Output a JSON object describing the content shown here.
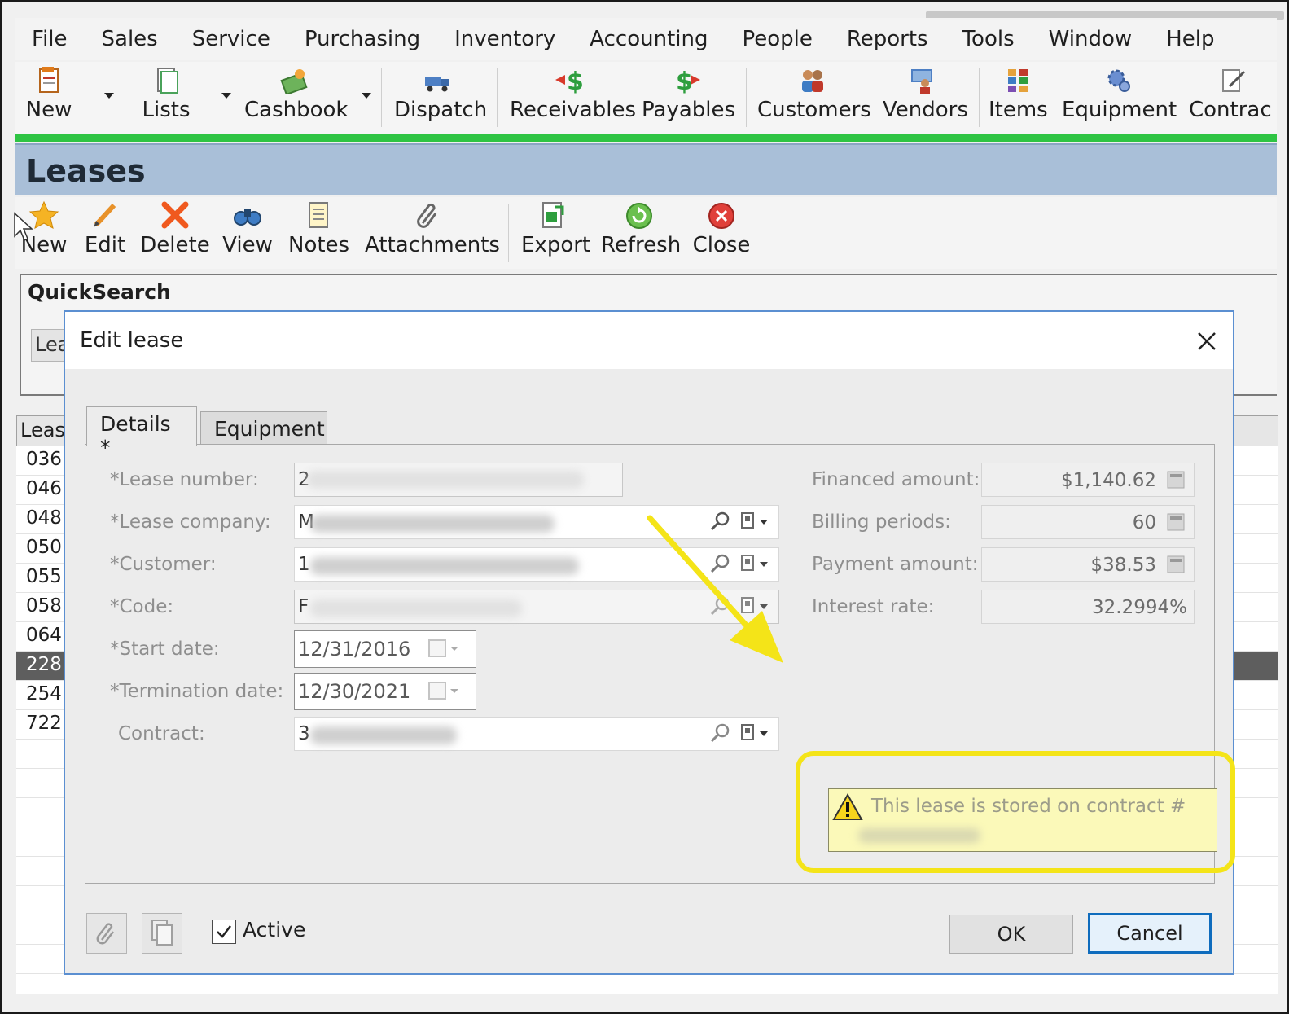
{
  "menu": [
    "File",
    "Sales",
    "Service",
    "Purchasing",
    "Inventory",
    "Accounting",
    "People",
    "Reports",
    "Tools",
    "Window",
    "Help"
  ],
  "toolbar": {
    "new": "New",
    "lists": "Lists",
    "cashbook": "Cashbook",
    "dispatch": "Dispatch",
    "receivables": "Receivables",
    "payables": "Payables",
    "customers": "Customers",
    "vendors": "Vendors",
    "items": "Items",
    "equipment": "Equipment",
    "contracts": "Contrac"
  },
  "leases": {
    "title": "Leases",
    "toolbar": {
      "new": "New",
      "edit": "Edit",
      "delete": "Delete",
      "view": "View",
      "notes": "Notes",
      "attachments": "Attachments",
      "export": "Export",
      "refresh": "Refresh",
      "close": "Close"
    },
    "quicksearch": {
      "label": "QuickSearch",
      "field": "Lea"
    },
    "grid": {
      "header": "Leas",
      "rows": [
        "036",
        "046",
        "048",
        "050",
        "055",
        "058",
        "064",
        "228",
        "254",
        "722"
      ],
      "selected_index": 7
    }
  },
  "dialog": {
    "title": "Edit lease",
    "tabs": {
      "details": "Details *",
      "equipment": "Equipment"
    },
    "fields": {
      "lease_number": {
        "label": "*Lease number:",
        "value": "2"
      },
      "lease_company": {
        "label": "*Lease company:",
        "value": "M"
      },
      "customer": {
        "label": "*Customer:",
        "value": "1"
      },
      "code": {
        "label": "*Code:",
        "value": "F"
      },
      "start_date": {
        "label": "*Start date:",
        "value": "12/31/2016"
      },
      "termination_date": {
        "label": "*Termination date:",
        "value": "12/30/2021"
      },
      "contract": {
        "label": "Contract:",
        "value": "3"
      },
      "financed_amount": {
        "label": "Financed amount:",
        "value": "$1,140.62"
      },
      "billing_periods": {
        "label": "Billing periods:",
        "value": "60"
      },
      "payment_amount": {
        "label": "Payment amount:",
        "value": "$38.53"
      },
      "interest_rate": {
        "label": "Interest rate:",
        "value": "32.2994%"
      }
    },
    "warning": "This lease is stored on contract #",
    "footer": {
      "active_label": "Active",
      "active_checked": true,
      "ok": "OK",
      "cancel": "Cancel"
    }
  },
  "colors": {
    "accent_green": "#2ec443",
    "header_blue": "#a9bfd8",
    "highlight_yellow": "#f4e418",
    "dialog_border": "#5b8fd1"
  }
}
